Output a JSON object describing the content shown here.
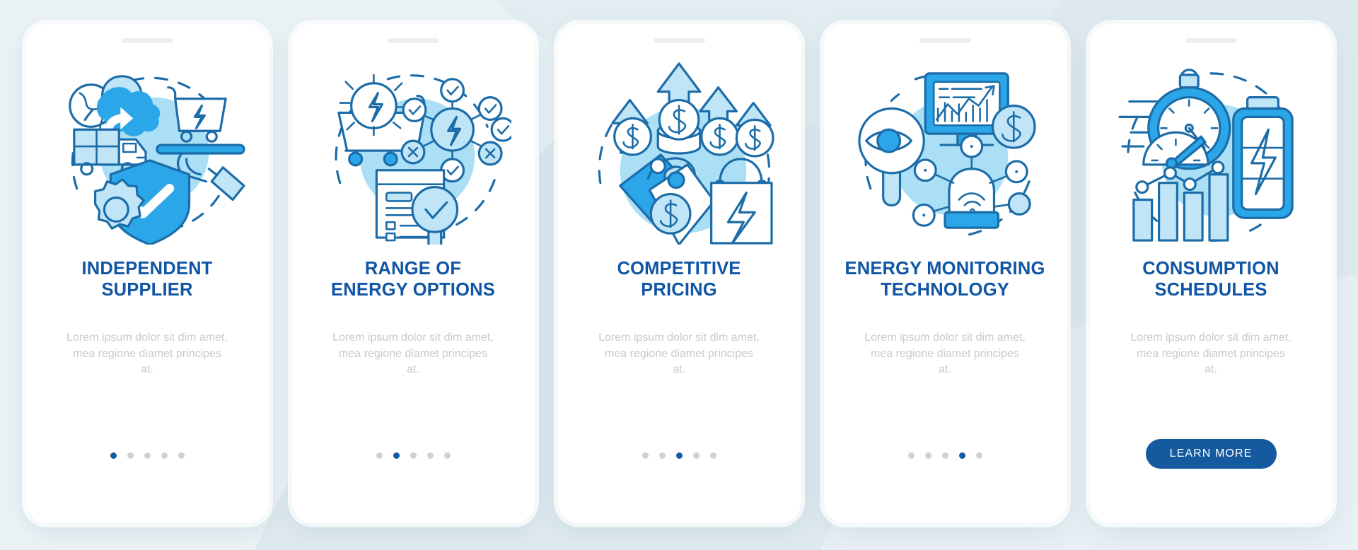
{
  "theme": {
    "page_background": "#dfeaef",
    "card_background": "#ffffff",
    "title_color": "#1156a5",
    "body_color": "#c9cacb",
    "accent_blue": "#2ba6e8",
    "deep_blue": "#1b6ca8",
    "dot_active": "#135ba4",
    "dot_inactive": "#cfd2d4",
    "button_background": "#15599f",
    "button_text": "#ffffff"
  },
  "shared": {
    "body_text": "Lorem ipsum dolor sit dim amet, mea regione diamet principes at.",
    "total_dots": 5
  },
  "screens": [
    {
      "index": 1,
      "title": "INDEPENDENT SUPPLIER",
      "title_lines": [
        "INDEPENDENT",
        "SUPPLIER"
      ],
      "body_text": "Lorem ipsum dolor sit dim amet, mea regione diamet principes at.",
      "illustration": "independent-supplier-illustration",
      "illustration_elements": [
        "globe-icon",
        "location-pin-icon",
        "delivery-truck-icon",
        "package-box-icon",
        "shopping-cart-lightning-icon",
        "serving-hand-icon",
        "shield-check-icon",
        "gear-icon"
      ],
      "active_dot": 1,
      "has_button": false,
      "button_label": null
    },
    {
      "index": 2,
      "title": "RANGE OF ENERGY OPTIONS",
      "title_lines": [
        "RANGE OF",
        "ENERGY OPTIONS"
      ],
      "body_text": "Lorem ipsum dolor sit dim amet, mea regione diamet principes at.",
      "illustration": "range-of-energy-options-illustration",
      "illustration_elements": [
        "shopping-cart-icon",
        "lightning-badge-icon",
        "network-nodes-icon",
        "check-circle-icon",
        "x-circle-icon",
        "document-icon",
        "magnifier-check-icon"
      ],
      "active_dot": 2,
      "has_button": false,
      "button_label": null
    },
    {
      "index": 3,
      "title": "COMPETITIVE PRICING",
      "title_lines": [
        "COMPETITIVE PRICING"
      ],
      "body_text": "Lorem ipsum dolor sit dim amet, mea regione diamet principes at.",
      "illustration": "competitive-pricing-illustration",
      "illustration_elements": [
        "up-arrow-icon",
        "dollar-coin-icon",
        "price-tag-icon",
        "shopping-bag-lightning-icon"
      ],
      "active_dot": 3,
      "has_button": false,
      "button_label": null
    },
    {
      "index": 4,
      "title": "ENERGY MONITORING TECHNOLOGY",
      "title_lines": [
        "ENERGY MONITORING",
        "TECHNOLOGY"
      ],
      "body_text": "Lorem ipsum dolor sit dim amet, mea regione diamet principes at.",
      "illustration": "energy-monitoring-technology-illustration",
      "illustration_elements": [
        "eye-magnifier-icon",
        "monitor-chart-icon",
        "dollar-circle-icon",
        "wifi-hub-icon",
        "network-node-icon"
      ],
      "active_dot": 4,
      "has_button": false,
      "button_label": null
    },
    {
      "index": 5,
      "title": "CONSUMPTION SCHEDULES",
      "title_lines": [
        "CONSUMPTION",
        "SCHEDULES"
      ],
      "body_text": "Lorem ipsum dolor sit dim amet, mea regione diamet principes at.",
      "illustration": "consumption-schedules-illustration",
      "illustration_elements": [
        "stopwatch-icon",
        "speed-gauge-icon",
        "bar-chart-icon",
        "line-graph-icon",
        "battery-lightning-icon"
      ],
      "active_dot": 5,
      "has_button": true,
      "button_label": "LEARN MORE"
    }
  ]
}
